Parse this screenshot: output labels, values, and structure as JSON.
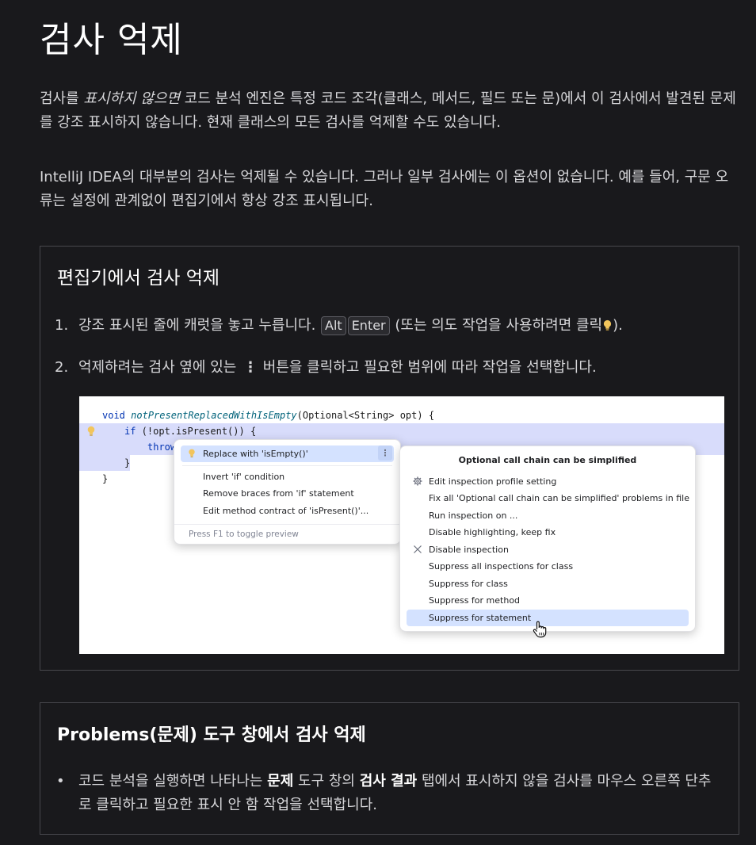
{
  "title": "검사 억제",
  "intro": {
    "p1_a": "검사를 ",
    "p1_em": "표시하지 않으면",
    "p1_b": " 코드 분석 엔진은 특정 코드 조각(클래스, 메서드, 필드 또는 문)에서 이 검사에서 발견된 문제를 강조 표시하지 않습니다. 현재 클래스의 모든 검사를 억제할 수도 있습니다.",
    "p2": "IntelliJ IDEA의 대부분의 검사는 억제될 수 있습니다. 그러나 일부 검사에는 이 옵션이 없습니다. 예를 들어, 구문 오류는 설정에 관계없이 편집기에서 항상 강조 표시됩니다."
  },
  "editor_section": {
    "heading": "편집기에서 검사 억제",
    "step1": {
      "num": "1.",
      "before": "강조 표시된 줄에 캐럿을 놓고 누릅니다. ",
      "key1": "Alt",
      "key2": "Enter",
      "after": " (또는 의도 작업을 사용하려면 클릭",
      "end": ")."
    },
    "step2": {
      "num": "2.",
      "before": "억제하려는 검사 옆에 있는 ",
      "dots": "⋮",
      "after": " 버튼을 클릭하고 필요한 범위에 따라 작업을 선택합니다."
    }
  },
  "screenshot": {
    "code": {
      "line1_kw": "void",
      "line1_fn": "notPresentReplacedWithIsEmpty",
      "line1_rest": "(Optional<String> opt) {",
      "line2_kw": "if",
      "line2_rest": " (!opt.isPresent()) {",
      "line3": "throw",
      "line4": "}",
      "line5": "}"
    },
    "intention_popup": {
      "items": [
        "Replace with 'isEmpty()'",
        "Invert 'if' condition",
        "Remove braces from 'if' statement",
        "Edit method contract of 'isPresent()'..."
      ],
      "more": "⋮",
      "hint": "Press F1 to toggle preview"
    },
    "options_popup": {
      "title": "Optional call chain can be simplified",
      "items": [
        "Edit inspection profile setting",
        "Fix all 'Optional call chain can be simplified' problems in file",
        "Run inspection on ...",
        "Disable highlighting, keep fix",
        "Disable inspection",
        "Suppress all inspections for class",
        "Suppress for class",
        "Suppress for method",
        "Suppress for statement"
      ]
    }
  },
  "problems_section": {
    "heading": "Problems(문제) 도구 창에서 검사 억제",
    "bullet": {
      "dot": "•",
      "a": "코드 분석을 실행하면 나타나는 ",
      "b1": "문제",
      "c": " 도구 창의 ",
      "b2": "검사 결과",
      "d": " 탭에서 표시하지 않을 검사를 마우스 오른쪽 단추로 클릭하고 필요한 표시 안 함 작업을 선택합니다."
    }
  },
  "colors": {
    "background": "#19191c",
    "selection": "#d4e2ff",
    "highlight": "#d8dcfb",
    "bulb": "#f2c55c"
  }
}
